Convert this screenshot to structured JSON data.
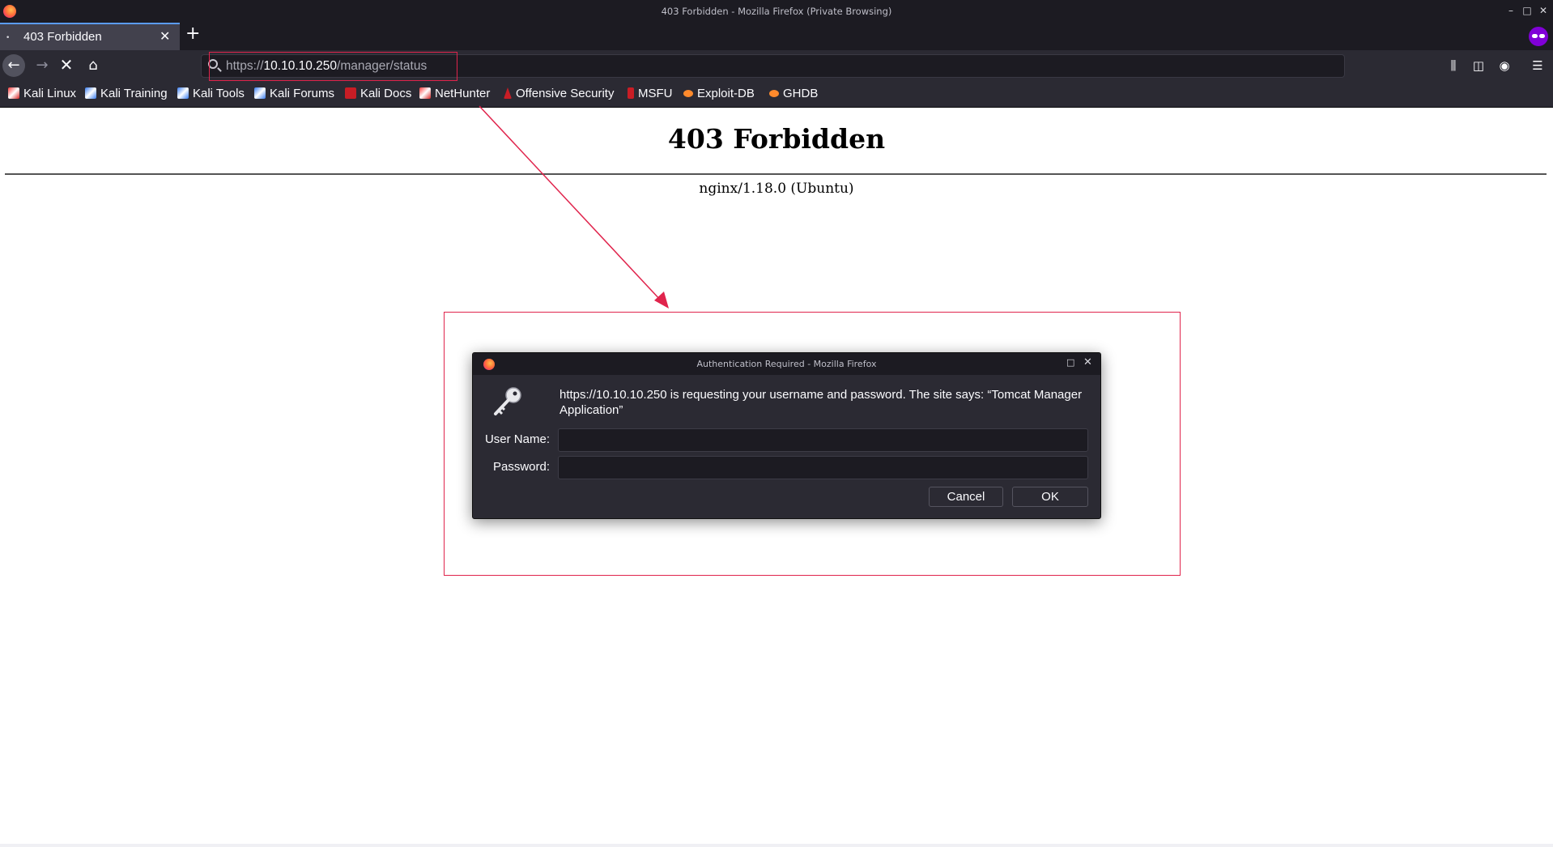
{
  "window": {
    "title": "403 Forbidden - Mozilla Firefox (Private Browsing)",
    "controls": {
      "minimize": "–",
      "maximize": "□",
      "close": "✕"
    }
  },
  "tabs": [
    {
      "label": "403 Forbidden",
      "active": true
    }
  ],
  "tabstrip": {
    "tab_dot": "•",
    "close_glyph": "✕",
    "new_tab_glyph": "+"
  },
  "navbar": {
    "back_glyph": "←",
    "forward_glyph": "→",
    "stop_glyph": "✕",
    "home_glyph": "⌂",
    "url": {
      "scheme": "https://",
      "host": "10.10.10.250",
      "path": "/manager/status"
    },
    "library_glyph": "⫼",
    "sidebar_glyph": "◫",
    "account_glyph": "◉",
    "menu_glyph": "☰"
  },
  "bookmarks": [
    {
      "label": "Kali Linux",
      "icon": "kali-red-icon"
    },
    {
      "label": "Kali Training",
      "icon": "kali-icon"
    },
    {
      "label": "Kali Tools",
      "icon": "kali-icon"
    },
    {
      "label": "Kali Forums",
      "icon": "kali-icon"
    },
    {
      "label": "Kali Docs",
      "icon": "docs-icon"
    },
    {
      "label": "NetHunter",
      "icon": "kali-red-icon"
    },
    {
      "label": "Offensive Security",
      "icon": "offsec-icon"
    },
    {
      "label": "MSFU",
      "icon": "msfu-icon"
    },
    {
      "label": "Exploit-DB",
      "icon": "exploitdb-icon"
    },
    {
      "label": "GHDB",
      "icon": "exploitdb-icon"
    }
  ],
  "page": {
    "heading": "403 Forbidden",
    "server": "nginx/1.18.0 (Ubuntu)"
  },
  "dialog": {
    "title": "Authentication Required - Mozilla Firefox",
    "max_glyph": "□",
    "close_glyph": "✕",
    "message": "https://10.10.10.250 is requesting your username and password. The site says: “Tomcat Manager Application”",
    "username_label": "User Name:",
    "password_label": "Password:",
    "username_value": "",
    "password_value": "",
    "cancel_label": "Cancel",
    "ok_label": "OK"
  },
  "colors": {
    "annotation": "#e0244c",
    "chrome_dark": "#1c1b22",
    "chrome": "#2b2a33",
    "private_purple": "#8000d7"
  }
}
